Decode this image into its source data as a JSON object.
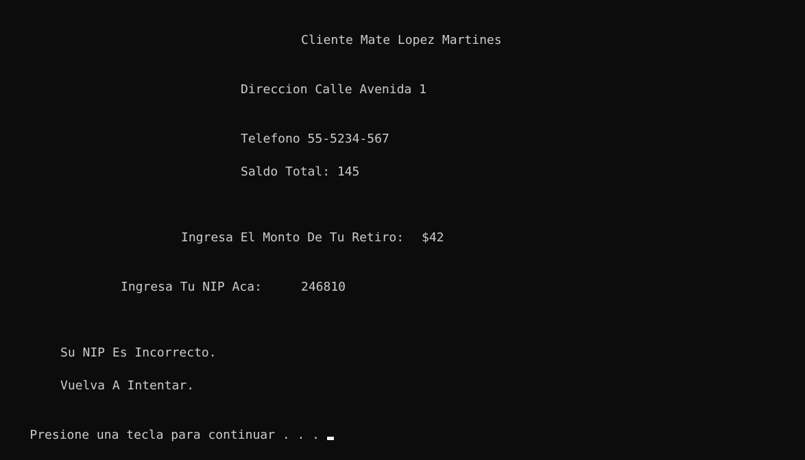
{
  "console": {
    "client_line": "Cliente Mate Lopez Martines",
    "address_line": "Direccion Calle Avenida 1",
    "phone_line": "Telefono 55-5234-567",
    "balance_line": "Saldo Total: 145",
    "withdraw_prompt": "Ingresa El Monto De Tu Retiro:",
    "withdraw_value": "$42",
    "pin_prompt": "Ingresa Tu NIP Aca:",
    "pin_value": "246810",
    "error_line": "Su NIP Es Incorrecto.",
    "retry_line": "Vuelva A Intentar.",
    "continue_prompt": "Presione una tecla para continuar . . ."
  },
  "colors": {
    "background": "#0c0c0c",
    "text": "#cccccc",
    "cursor": "#f2f2f2"
  }
}
